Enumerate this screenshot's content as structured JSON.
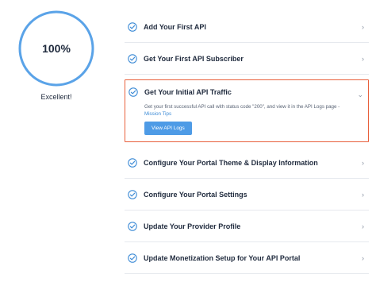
{
  "progress": {
    "percent_text": "100%",
    "value": 1.0,
    "status": "Excellent!",
    "ring_color": "#5aa3e8"
  },
  "checklist": {
    "items": [
      {
        "label": "Add Your First API",
        "icon": "check-circle-icon",
        "chevron": "chevron-right-icon"
      },
      {
        "label": "Get Your First API Subscriber",
        "icon": "check-circle-icon",
        "chevron": "chevron-right-icon"
      },
      {
        "label": "Get Your Initial API Traffic",
        "icon": "check-circle-icon",
        "chevron": "chevron-down-icon",
        "expanded": true,
        "description": "Get your first successful API call with status code \"200\", and view it in the API Logs page -",
        "link_text": "Mission Tips",
        "button_label": "View API Logs"
      },
      {
        "label": "Configure Your Portal Theme & Display Information",
        "icon": "check-circle-icon",
        "chevron": "chevron-right-icon"
      },
      {
        "label": "Configure Your Portal Settings",
        "icon": "check-circle-icon",
        "chevron": "chevron-right-icon"
      },
      {
        "label": "Update Your Provider Profile",
        "icon": "check-circle-icon",
        "chevron": "chevron-right-icon"
      },
      {
        "label": "Update Monetization Setup for Your API Portal",
        "icon": "check-circle-icon",
        "chevron": "chevron-right-icon"
      }
    ]
  },
  "colors": {
    "accent": "#3d8bd6",
    "highlight_border": "#e8603c",
    "check": "#3d8bd6"
  },
  "glyphs": {
    "chevron_right": "›",
    "chevron_down": "⌄"
  }
}
